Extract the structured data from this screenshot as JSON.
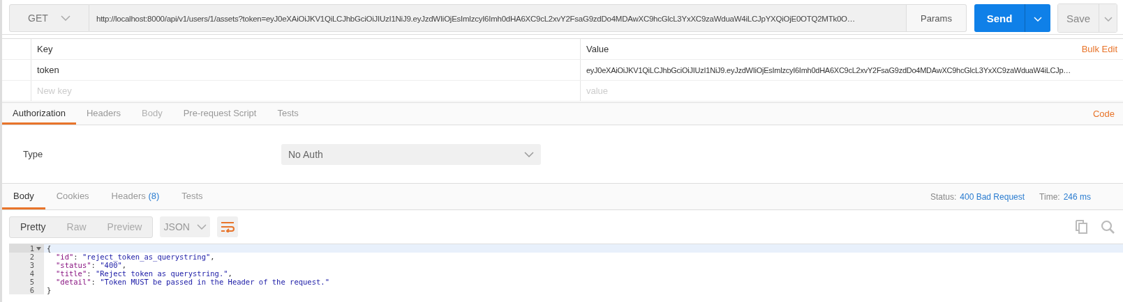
{
  "request": {
    "method": "GET",
    "url": "http://localhost:8000/api/v1/users/1/assets?token=eyJ0eXAiOiJKV1QiLCJhbGciOiJIUzI1NiJ9.eyJzdWIiOjEsImlzcyI6Imh0dHA6XC9cL2xvY2FsaG9zdDo4MDAwXC9hcGlcL3YxXC9zaWduaW4iLCJpYXQiOjE0OTQ2MTk0O…",
    "params_button": "Params",
    "send_button": "Send",
    "save_button": "Save"
  },
  "params": {
    "columns": [
      "Key",
      "Value"
    ],
    "bulk_edit": "Bulk Edit",
    "rows": [
      {
        "key": "token",
        "value": "eyJ0eXAiOiJKV1QiLCJhbGciOiJIUzI1NiJ9.eyJzdWIiOjEsImlzcyI6Imh0dHA6XC9cL2xvY2FsaG9zdDo4MDAwXC9hcGlcL3YxXC9zaWduaW4iLCJp…"
      }
    ],
    "new_row": {
      "key_placeholder": "New key",
      "value_placeholder": "value"
    }
  },
  "request_tabs": [
    {
      "label": "Authorization",
      "selected": true,
      "disabled": false
    },
    {
      "label": "Headers",
      "selected": false,
      "disabled": false
    },
    {
      "label": "Body",
      "selected": false,
      "disabled": true
    },
    {
      "label": "Pre-request Script",
      "selected": false,
      "disabled": false
    },
    {
      "label": "Tests",
      "selected": false,
      "disabled": false
    }
  ],
  "code_link": "Code",
  "auth": {
    "label": "Type",
    "value": "No Auth"
  },
  "response_tabs": [
    {
      "label": "Body",
      "selected": true
    },
    {
      "label": "Cookies",
      "selected": false
    },
    {
      "label": "Headers",
      "count": "(8)",
      "selected": false
    },
    {
      "label": "Tests",
      "selected": false
    }
  ],
  "status": {
    "label": "Status:",
    "value": "400 Bad Request"
  },
  "time": {
    "label": "Time:",
    "value": "246 ms"
  },
  "view_modes": [
    {
      "label": "Pretty",
      "selected": true
    },
    {
      "label": "Raw",
      "selected": false
    },
    {
      "label": "Preview",
      "selected": false
    }
  ],
  "format": "JSON",
  "code_lines": [
    {
      "number": "1",
      "active": true,
      "foldable": true,
      "kind": "brace",
      "tokens": [
        {
          "kind": "punct",
          "text": "{"
        }
      ]
    },
    {
      "number": "2",
      "active": false,
      "foldable": false,
      "kind": "member",
      "tokens": [
        {
          "kind": "key",
          "text": "\"id\""
        },
        {
          "kind": "punct",
          "text": ":"
        },
        {
          "kind": "string",
          "text": "\"reject_token_as_querystring\""
        },
        {
          "kind": "punct",
          "text": ","
        }
      ]
    },
    {
      "number": "3",
      "active": false,
      "foldable": false,
      "kind": "member",
      "tokens": [
        {
          "kind": "key",
          "text": "\"status\""
        },
        {
          "kind": "punct",
          "text": ":"
        },
        {
          "kind": "string",
          "text": "\"400\""
        },
        {
          "kind": "punct",
          "text": ","
        }
      ]
    },
    {
      "number": "4",
      "active": false,
      "foldable": false,
      "kind": "member",
      "tokens": [
        {
          "kind": "key",
          "text": "\"title\""
        },
        {
          "kind": "punct",
          "text": ":"
        },
        {
          "kind": "string",
          "text": "\"Reject token as querystring.\""
        },
        {
          "kind": "punct",
          "text": ","
        }
      ]
    },
    {
      "number": "5",
      "active": false,
      "foldable": false,
      "kind": "member",
      "tokens": [
        {
          "kind": "key",
          "text": "\"detail\""
        },
        {
          "kind": "punct",
          "text": ":"
        },
        {
          "kind": "string",
          "text": "\"Token MUST be passed in the Header of the request.\""
        }
      ]
    },
    {
      "number": "6",
      "active": false,
      "foldable": false,
      "kind": "brace",
      "tokens": [
        {
          "kind": "punct",
          "text": "}"
        }
      ]
    }
  ]
}
